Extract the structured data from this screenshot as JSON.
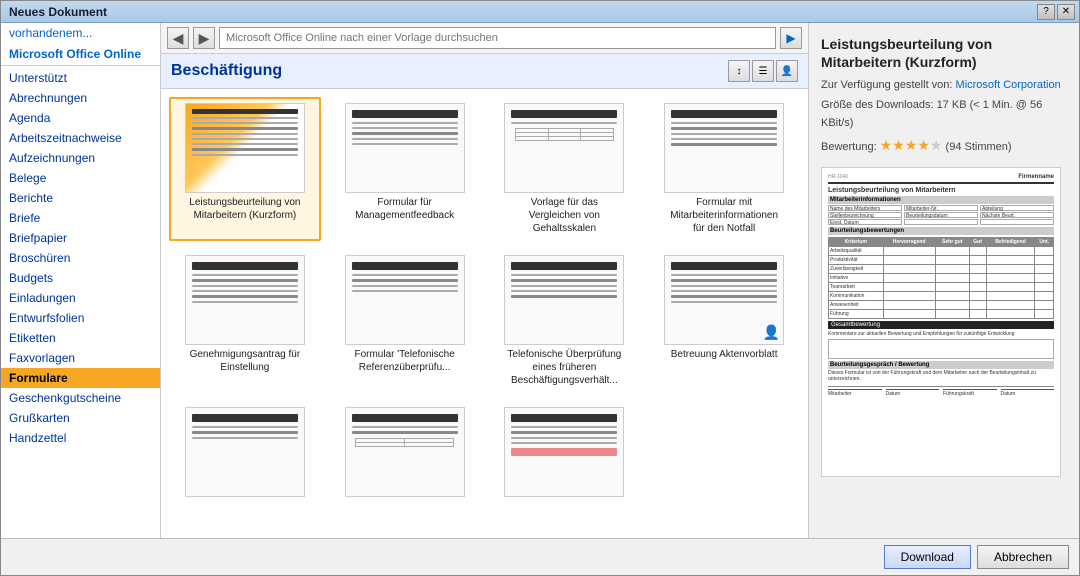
{
  "window": {
    "title": "Neues Dokument",
    "controls": [
      "?",
      "✕"
    ]
  },
  "sidebar": {
    "items": [
      {
        "id": "vorhandene",
        "label": "vorhandenem...",
        "type": "link"
      },
      {
        "id": "office-online",
        "label": "Microsoft Office Online",
        "type": "section-header"
      },
      {
        "id": "unterstuetzt",
        "label": "Unterstützt",
        "type": "item"
      },
      {
        "id": "abrechnungen",
        "label": "Abrechnungen",
        "type": "item"
      },
      {
        "id": "agenda",
        "label": "Agenda",
        "type": "item"
      },
      {
        "id": "arbeitszeitnachweise",
        "label": "Arbeitszeitnachweise",
        "type": "item"
      },
      {
        "id": "aufzeichnungen",
        "label": "Aufzeichnungen",
        "type": "item"
      },
      {
        "id": "belege",
        "label": "Belege",
        "type": "item"
      },
      {
        "id": "berichte",
        "label": "Berichte",
        "type": "item"
      },
      {
        "id": "briefe",
        "label": "Briefe",
        "type": "item"
      },
      {
        "id": "briefpapier",
        "label": "Briefpapier",
        "type": "item"
      },
      {
        "id": "broschueren",
        "label": "Broschüren",
        "type": "item"
      },
      {
        "id": "budgets",
        "label": "Budgets",
        "type": "item"
      },
      {
        "id": "einladungen",
        "label": "Einladungen",
        "type": "item"
      },
      {
        "id": "entwurfsfolien",
        "label": "Entwurfsfolien",
        "type": "item"
      },
      {
        "id": "etiketten",
        "label": "Etiketten",
        "type": "item"
      },
      {
        "id": "faxvorlagen",
        "label": "Faxvorlagen",
        "type": "item"
      },
      {
        "id": "formulare",
        "label": "Formulare",
        "type": "item",
        "active": true
      },
      {
        "id": "geschenkgutscheine",
        "label": "Geschenkgutscheine",
        "type": "item"
      },
      {
        "id": "grusskarten",
        "label": "Grußkarten",
        "type": "item"
      },
      {
        "id": "handzettel",
        "label": "Handzettel",
        "type": "item"
      }
    ]
  },
  "toolbar": {
    "back_icon": "◀",
    "forward_icon": "▶",
    "search_placeholder": "Microsoft Office Online nach einer Vorlage durchsuchen",
    "go_icon": "▶"
  },
  "category": {
    "title": "Beschäftigung",
    "actions": [
      "sort-icon",
      "list-icon",
      "person-icon"
    ]
  },
  "templates": [
    {
      "id": "leistungsbeurteilung",
      "label": "Leistungsbeurteilung von Mitarbeitern (Kurzform)",
      "selected": true,
      "has_person": false
    },
    {
      "id": "managementfeedback",
      "label": "Formular für Managementfeedback",
      "selected": false,
      "has_person": false
    },
    {
      "id": "gehaltsskalen",
      "label": "Vorlage für das Vergleichen von Gehaltsskalen",
      "selected": false,
      "has_person": false
    },
    {
      "id": "mitarbeiternotfall",
      "label": "Formular mit Mitarbeiterinformationen für den Notfall",
      "selected": false,
      "has_person": false
    },
    {
      "id": "genehmigungsantrag",
      "label": "Genehmigungsantrag für Einstellung",
      "selected": false,
      "has_person": false
    },
    {
      "id": "referenzueberpruefung",
      "label": "Formular 'Telefonische Referenzüberprüfu...",
      "selected": false,
      "has_person": false
    },
    {
      "id": "telefonische-ueberpruefung",
      "label": "Telefonische Überprüfung eines früheren Beschäftigungsverhält...",
      "selected": false,
      "has_person": false
    },
    {
      "id": "betreuung",
      "label": "Betreuung Aktenvorblatt",
      "selected": false,
      "has_person": true
    },
    {
      "id": "template9",
      "label": "",
      "selected": false,
      "has_person": false
    },
    {
      "id": "template10",
      "label": "",
      "selected": false,
      "has_person": false
    },
    {
      "id": "template11",
      "label": "",
      "selected": false,
      "has_person": false
    }
  ],
  "preview": {
    "title": "Leistungsbeurteilung von Mitarbeitern (Kurzform)",
    "provider_label": "Zur Verfügung gestellt von:",
    "provider_name": "Microsoft Corporation",
    "size_label": "Größe des Downloads:",
    "size_value": "17 KB (< 1 Min. @ 56 KBit/s)",
    "rating_label": "Bewertung:",
    "rating_value": "(94 Stimmen)",
    "stars_full": 4,
    "stars_empty": 1
  },
  "buttons": {
    "download": "Download",
    "cancel": "Abbrechen"
  }
}
